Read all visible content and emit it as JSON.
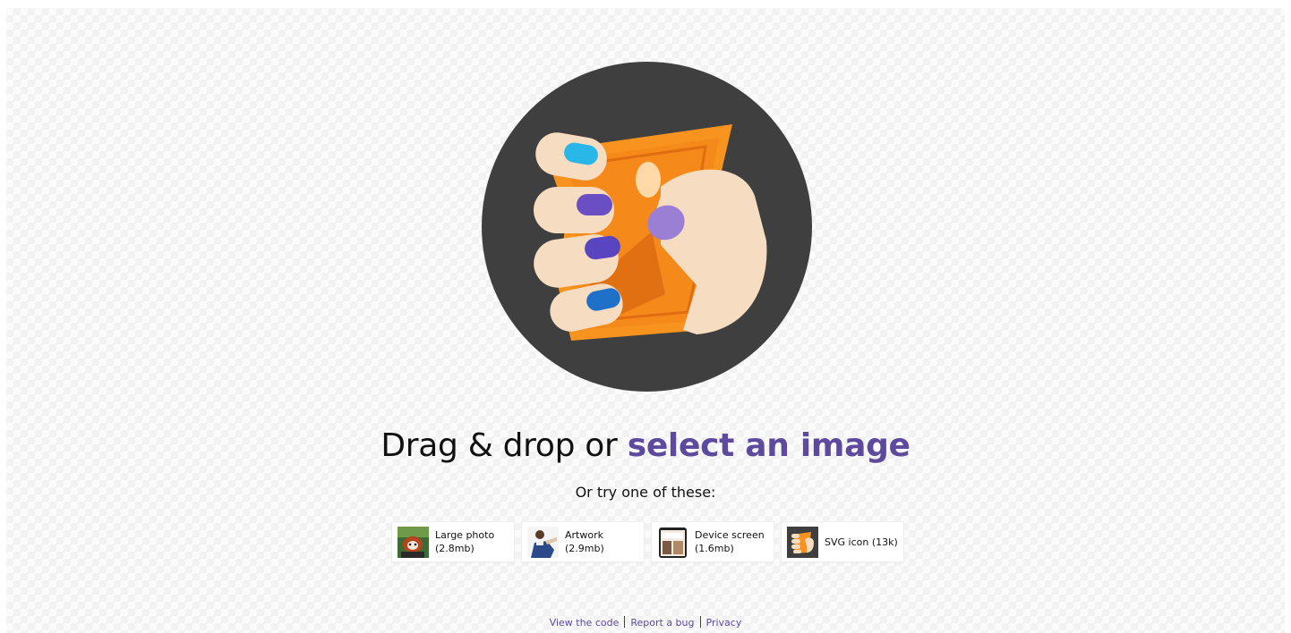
{
  "drop_zone": {
    "headline_prefix": "Drag & drop or",
    "select_link": "select an image",
    "subtitle": "Or try one of these:"
  },
  "samples": [
    {
      "name": "Large photo",
      "size": "(2.8mb)",
      "icon": "red-panda-photo"
    },
    {
      "name": "Artwork",
      "size": "(2.9mb)",
      "icon": "artwork-figure"
    },
    {
      "name": "Device screen",
      "size": "(1.6mb)",
      "icon": "device-screenshot"
    },
    {
      "name": "SVG icon (13k)",
      "size": "",
      "icon": "squoosh-logo"
    }
  ],
  "footer": {
    "links": [
      "View the code",
      "Report a bug",
      "Privacy"
    ]
  },
  "colors": {
    "accent": "#5d4a9e",
    "logo_circle": "#3f3f3f",
    "logo_orange": "#f7931e",
    "nail_blue": "#1e88e5",
    "nail_purple": "#6a4fc4"
  }
}
